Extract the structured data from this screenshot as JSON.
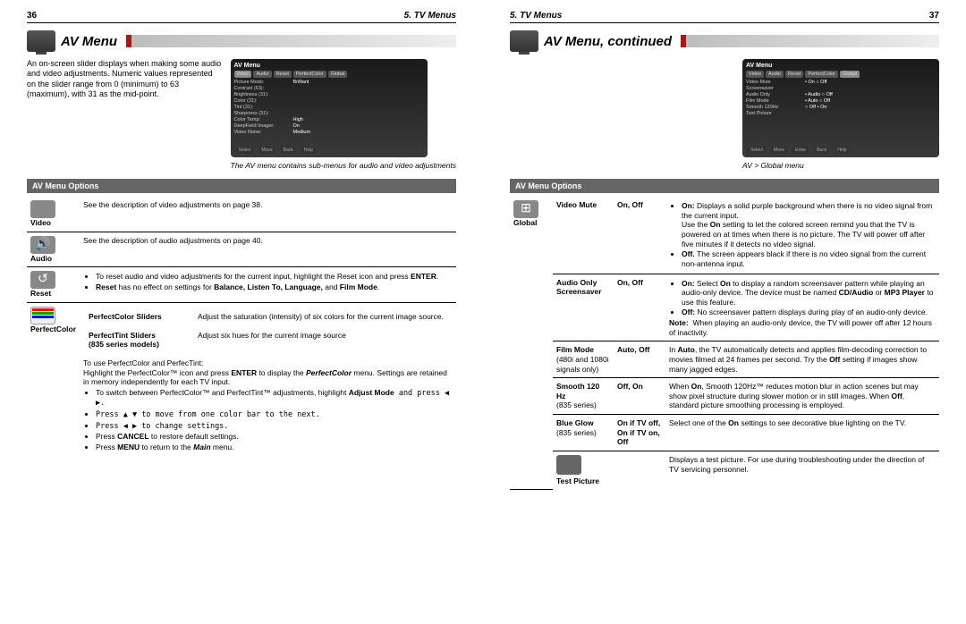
{
  "left": {
    "pagenum": "36",
    "chapter": "5.  TV Menus",
    "title": "AV Menu",
    "intro": "An on-screen slider displays when making some audio and video adjustments. Numeric values represented on the slider range from 0 (minimum) to 63 (maximum), with 31 as the mid-point.",
    "caption": "The AV menu contains sub-menus for audio and video adjustments",
    "opts_header": "AV Menu Options",
    "screenshot": {
      "title": "AV Menu",
      "tabs": [
        "Video",
        "Audio",
        "Reset",
        "PerfectColor",
        "Global"
      ],
      "rows": [
        {
          "k": "Picture Mode:",
          "v": "Brilliant"
        },
        {
          "k": "Contrast (63):",
          "v": ""
        },
        {
          "k": "Brightness (31):",
          "v": ""
        },
        {
          "k": "Color (31):",
          "v": ""
        },
        {
          "k": "Tint (31):",
          "v": ""
        },
        {
          "k": "Sharpness (31):",
          "v": ""
        },
        {
          "k": "Color Temp:",
          "v": "High"
        },
        {
          "k": "DeepField Imager:",
          "v": "On"
        },
        {
          "k": "Video Noise:",
          "v": "Medium"
        }
      ],
      "footer": [
        "Select",
        "Move",
        "Back",
        "Help"
      ]
    },
    "rows": {
      "video": {
        "label": "Video",
        "desc": "See the description of video adjustments on page 38."
      },
      "audio": {
        "label": "Audio",
        "desc": "See the description of audio adjustments on page 40."
      },
      "reset": {
        "label": "Reset",
        "b1": "To reset audio and video adjustments for the current input, highlight the Reset icon and press",
        "b1k": "ENTER",
        "b1e": ".",
        "b2a": "Reset",
        "b2b": " has no effect on settings for ",
        "b2c": "Balance, Listen To, Language,",
        "b2d": " and ",
        "b2e": "Film Mode",
        "b2f": "."
      },
      "pc": {
        "label": "PerfectColor",
        "pcs_h": "PerfectColor Sliders",
        "pcs_d": "Adjust the saturation (intensity) of six colors for the current image source.",
        "pts_h": "PerfectTint Sliders",
        "pts_sub": "(835 series models)",
        "pts_d": "Adjust six hues for the current image source",
        "use": "To use PerfectColor and PerfecTint:",
        "hl1a": "Highlight the PerfectColor™ icon and press ",
        "hl1b": "ENTER",
        "hl1c": " to display the ",
        "hl1d": "PerfectColor",
        "hl1e": " menu.  Settings are retained in memory independently for each TV input.",
        "li1a": "To switch between PerfectColor™ and PerfectTint™ adjustments, highlight ",
        "li1b": "Adjust Mode",
        "li1c": " and press ◀ ▶.",
        "li2": "Press ▲ ▼ to move from one color bar to the next.",
        "li3": "Press ◀ ▶ to change settings.",
        "li4a": "Press ",
        "li4b": "CANCEL",
        "li4c": " to restore default settings.",
        "li5a": "Press ",
        "li5b": "MENU",
        "li5c": " to return to the ",
        "li5d": "Main",
        "li5e": " menu."
      }
    }
  },
  "right": {
    "pagenum": "37",
    "chapter": "5.  TV Menus",
    "title": "AV Menu, continued",
    "caption": "AV > Global menu",
    "opts_header": "AV Menu Options",
    "screenshot": {
      "title": "AV Menu",
      "tabs": [
        "Video",
        "Audio",
        "Reset",
        "PerfectColor",
        "Global"
      ],
      "rows": [
        {
          "k": "Video Mute",
          "v": "• On  ○ Off"
        },
        {
          "k": "Screensaver",
          "v": ""
        },
        {
          "k": "Audio Only",
          "v": "• Audio  ○ Off"
        },
        {
          "k": "Film Mode",
          "v": "• Auto  ○ Off"
        },
        {
          "k": "Smooth 120Hz",
          "v": "○ Off  • On"
        },
        {
          "k": "Test Picture",
          "v": ""
        }
      ],
      "footer": [
        "Select",
        "Move",
        "Enter",
        "Back",
        "Help"
      ]
    },
    "global_label": "Global",
    "settings": {
      "vm": {
        "label": "Video Mute",
        "val": "On, Off",
        "on": "Displays a solid purple background when there is no video signal from the current input.",
        "on2": "Use the ",
        "on2b": "On",
        "on2c": " setting to let the colored screen remind you that the TV is powered on at times when there is no picture.  The TV will power off after five minutes if it detects no video signal.",
        "off": "The screen appears black if there is no video signal from the current non-antenna input."
      },
      "ao": {
        "label": "Audio Only Screensaver",
        "val": "On, Off",
        "on1a": "Select ",
        "on1b": "On",
        "on1c": " to display a random screensaver pattern while playing an audio-only device. The device must be named ",
        "on1d": "CD/Audio",
        "on1e": " or ",
        "on1f": "MP3 Player",
        "on1g": " to use this feature.",
        "off1a": "No screensaver pattern displays during play of an audio-only device.",
        "note_l": "Note:",
        "note": "When playing an audio-only device, the TV will power off after 12 hours of inactivity."
      },
      "fm": {
        "label": "Film Mode",
        "sub": "(480i and 1080i signals only)",
        "val": "Auto, Off",
        "d1a": "In ",
        "d1b": "Auto",
        "d1c": ", the TV automatically detects and applies film-decoding correction to movies filmed at 24 frames per second.  Try the ",
        "d1d": "Off",
        "d1e": " setting if images show many jagged edges."
      },
      "s120": {
        "label": "Smooth 120 Hz",
        "sub": "(835 series)",
        "val": "Off, On",
        "d1a": "When ",
        "d1b": "On",
        "d1c": ", Smooth 120Hz™ reduces motion blur in action scenes but may show pixel structure during slower motion or in still images.  When ",
        "d1d": "Off",
        "d1e": ", standard picture smoothing processing is employed."
      },
      "bg": {
        "label": "Blue Glow",
        "sub": "(835 series)",
        "val": "On if TV off, On if TV on, Off",
        "d": "Select one of the ",
        "db": "On",
        "dc": " settings to see decorative blue lighting on the TV."
      },
      "tp": {
        "label": "Test Picture",
        "d": "Displays a test picture.  For use during troubleshooting under the direction of TV servicing personnel."
      }
    }
  }
}
